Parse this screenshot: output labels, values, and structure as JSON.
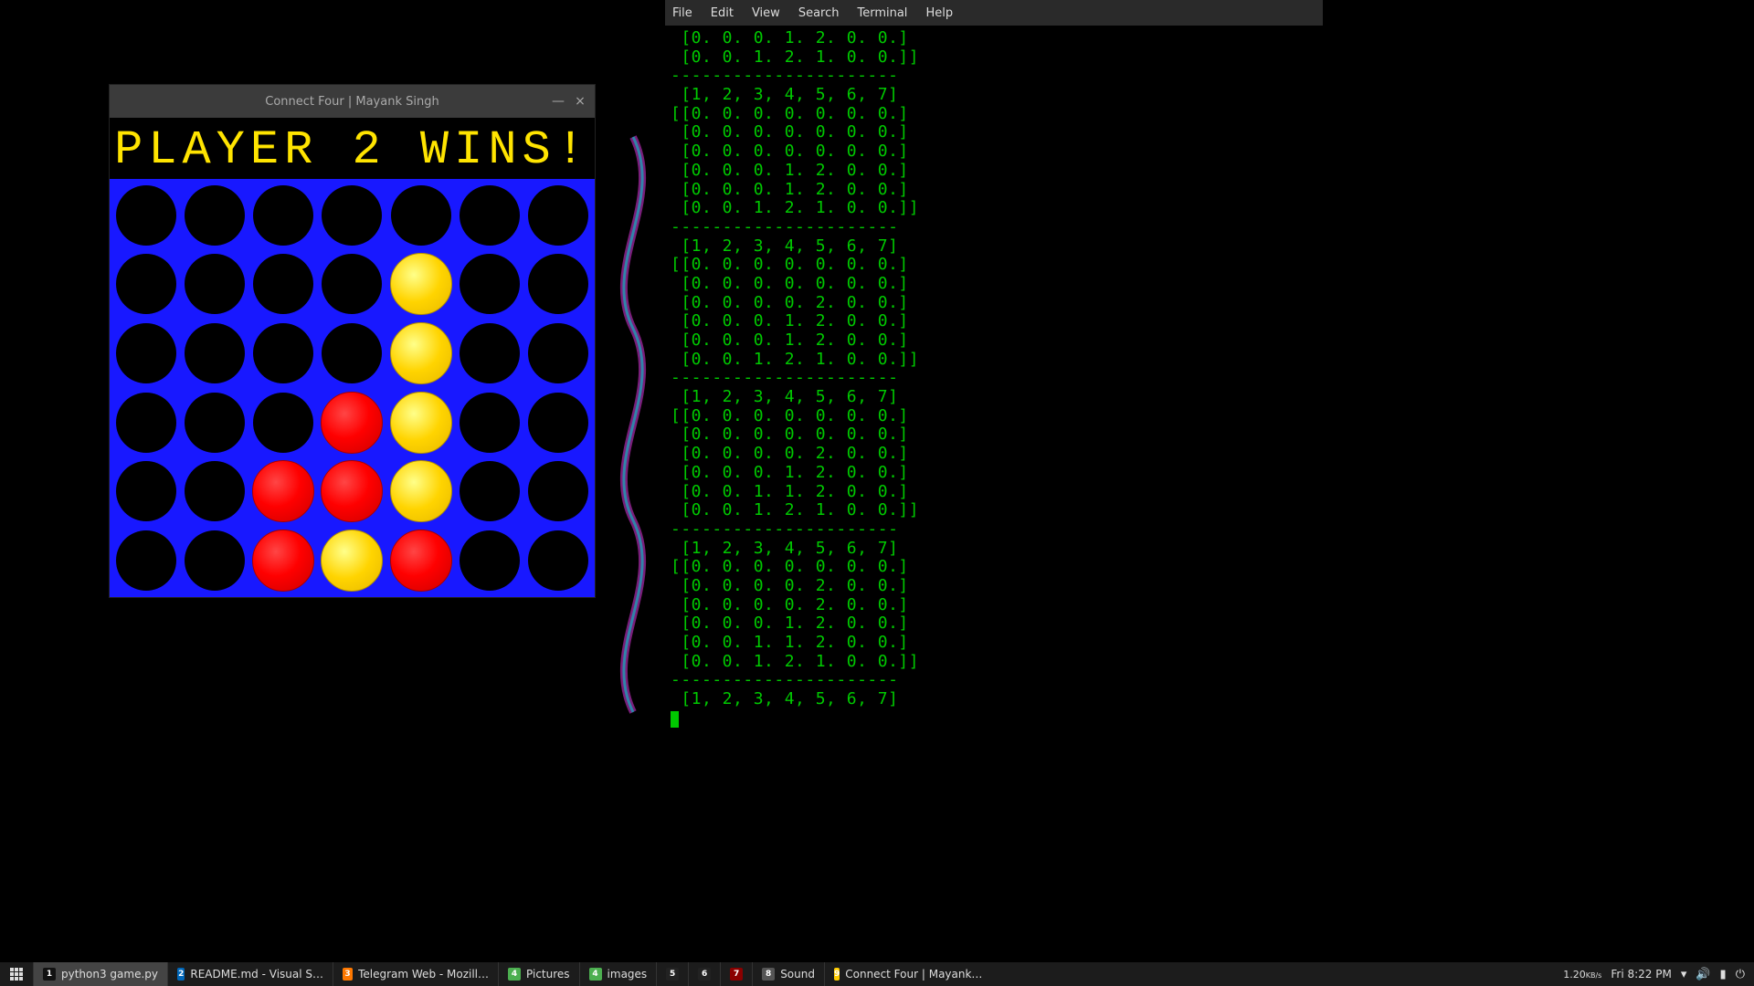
{
  "game": {
    "title": "Connect Four | Mayank Singh",
    "status": "PLAYER 2 WINS!",
    "columns": 7,
    "rows": 6,
    "board_comment": "0=empty, 1=red(player1), 2=yellow(player2); row 0 is top",
    "board": [
      [
        0,
        0,
        0,
        0,
        0,
        0,
        0
      ],
      [
        0,
        0,
        0,
        0,
        2,
        0,
        0
      ],
      [
        0,
        0,
        0,
        0,
        2,
        0,
        0
      ],
      [
        0,
        0,
        0,
        1,
        2,
        0,
        0
      ],
      [
        0,
        0,
        1,
        1,
        2,
        0,
        0
      ],
      [
        0,
        0,
        1,
        2,
        1,
        0,
        0
      ]
    ]
  },
  "terminal": {
    "menu": [
      "File",
      "Edit",
      "View",
      "Search",
      "Terminal",
      "Help"
    ],
    "lines": [
      " [0. 0. 0. 1. 2. 0. 0.]",
      " [0. 0. 1. 2. 1. 0. 0.]]",
      "----------------------",
      " [1, 2, 3, 4, 5, 6, 7]",
      "[[0. 0. 0. 0. 0. 0. 0.]",
      " [0. 0. 0. 0. 0. 0. 0.]",
      " [0. 0. 0. 0. 0. 0. 0.]",
      " [0. 0. 0. 1. 2. 0. 0.]",
      " [0. 0. 0. 1. 2. 0. 0.]",
      " [0. 0. 1. 2. 1. 0. 0.]]",
      "----------------------",
      " [1, 2, 3, 4, 5, 6, 7]",
      "[[0. 0. 0. 0. 0. 0. 0.]",
      " [0. 0. 0. 0. 0. 0. 0.]",
      " [0. 0. 0. 0. 2. 0. 0.]",
      " [0. 0. 0. 1. 2. 0. 0.]",
      " [0. 0. 0. 1. 2. 0. 0.]",
      " [0. 0. 1. 2. 1. 0. 0.]]",
      "----------------------",
      " [1, 2, 3, 4, 5, 6, 7]",
      "[[0. 0. 0. 0. 0. 0. 0.]",
      " [0. 0. 0. 0. 0. 0. 0.]",
      " [0. 0. 0. 0. 2. 0. 0.]",
      " [0. 0. 0. 1. 2. 0. 0.]",
      " [0. 0. 1. 1. 2. 0. 0.]",
      " [0. 0. 1. 2. 1. 0. 0.]]",
      "----------------------",
      " [1, 2, 3, 4, 5, 6, 7]",
      "[[0. 0. 0. 0. 0. 0. 0.]",
      " [0. 0. 0. 0. 2. 0. 0.]",
      " [0. 0. 0. 0. 2. 0. 0.]",
      " [0. 0. 0. 1. 2. 0. 0.]",
      " [0. 0. 1. 1. 2. 0. 0.]",
      " [0. 0. 1. 2. 1. 0. 0.]]",
      "----------------------",
      " [1, 2, 3, 4, 5, 6, 7]"
    ]
  },
  "taskbar": {
    "items": [
      {
        "label": "python3 game.py",
        "icon_bg": "#111",
        "icon_txt": "1",
        "active": true
      },
      {
        "label": "README.md - Visual S…",
        "icon_bg": "#0066b8",
        "icon_txt": "2"
      },
      {
        "label": "Telegram Web - Mozill…",
        "icon_bg": "#ff7800",
        "icon_txt": "3"
      },
      {
        "label": "Pictures",
        "icon_bg": "#4caf50",
        "icon_txt": "4"
      },
      {
        "label": "images",
        "icon_bg": "#4caf50",
        "icon_txt": "4"
      },
      {
        "label": "",
        "icon_bg": "#222",
        "icon_txt": "5"
      },
      {
        "label": "",
        "icon_bg": "#222",
        "icon_txt": "6"
      },
      {
        "label": "",
        "icon_bg": "#8b0000",
        "icon_txt": "7"
      },
      {
        "label": "Sound",
        "icon_bg": "#555",
        "icon_txt": "8"
      },
      {
        "label": "Connect Four | Mayank…",
        "icon_bg": "#ffcc00",
        "icon_txt": "9"
      }
    ],
    "net_rate": "1.20",
    "net_unit": "KB/s",
    "clock": "Fri  8:22 PM"
  },
  "colors": {
    "board_bg": "#1818ff",
    "empty": "#000000",
    "player1": "#ff0000",
    "player2": "#ffd400",
    "terminal_fg": "#00c800"
  }
}
